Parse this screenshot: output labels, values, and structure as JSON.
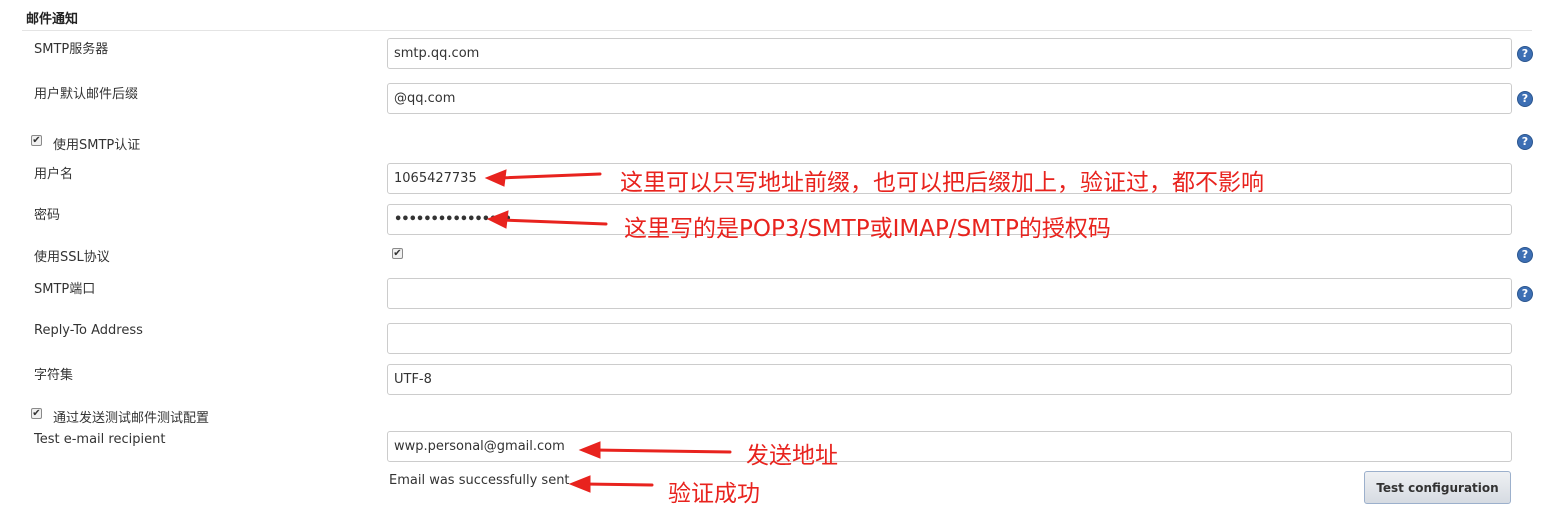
{
  "section": {
    "title": "邮件通知"
  },
  "fields": {
    "smtp_server": {
      "label": "SMTP服务器",
      "value": "smtp.qq.com"
    },
    "default_suffix": {
      "label": "用户默认邮件后缀",
      "value": "@qq.com"
    },
    "use_smtp_auth": {
      "label": "使用SMTP认证",
      "checked": true
    },
    "username": {
      "label": "用户名",
      "value": "1065427735"
    },
    "password": {
      "label": "密码",
      "value": "••••••••••••••••"
    },
    "use_ssl": {
      "label": "使用SSL协议",
      "checked": true
    },
    "smtp_port": {
      "label": "SMTP端口",
      "value": ""
    },
    "reply_to": {
      "label": "Reply-To Address",
      "value": ""
    },
    "charset": {
      "label": "字符集",
      "value": "UTF-8"
    },
    "test_by_sending": {
      "label": "通过发送测试邮件测试配置",
      "checked": true
    },
    "test_recipient": {
      "label": "Test e-mail recipient",
      "value": "wwp.personal@gmail.com"
    }
  },
  "status_text": "Email was successfully sent",
  "test_button_label": "Test configuration",
  "help_icon_glyph": "?",
  "checkbox_glyph": "✔",
  "annotations": {
    "username_note": "这里可以只写地址前缀，也可以把后缀加上，验证过，都不影响",
    "password_note": "这里写的是POP3/SMTP或IMAP/SMTP的授权码",
    "recipient_note": "发送地址",
    "status_note": "验证成功"
  },
  "colors": {
    "annotation": "#e8231e",
    "help_icon": "#3d6fb4"
  }
}
